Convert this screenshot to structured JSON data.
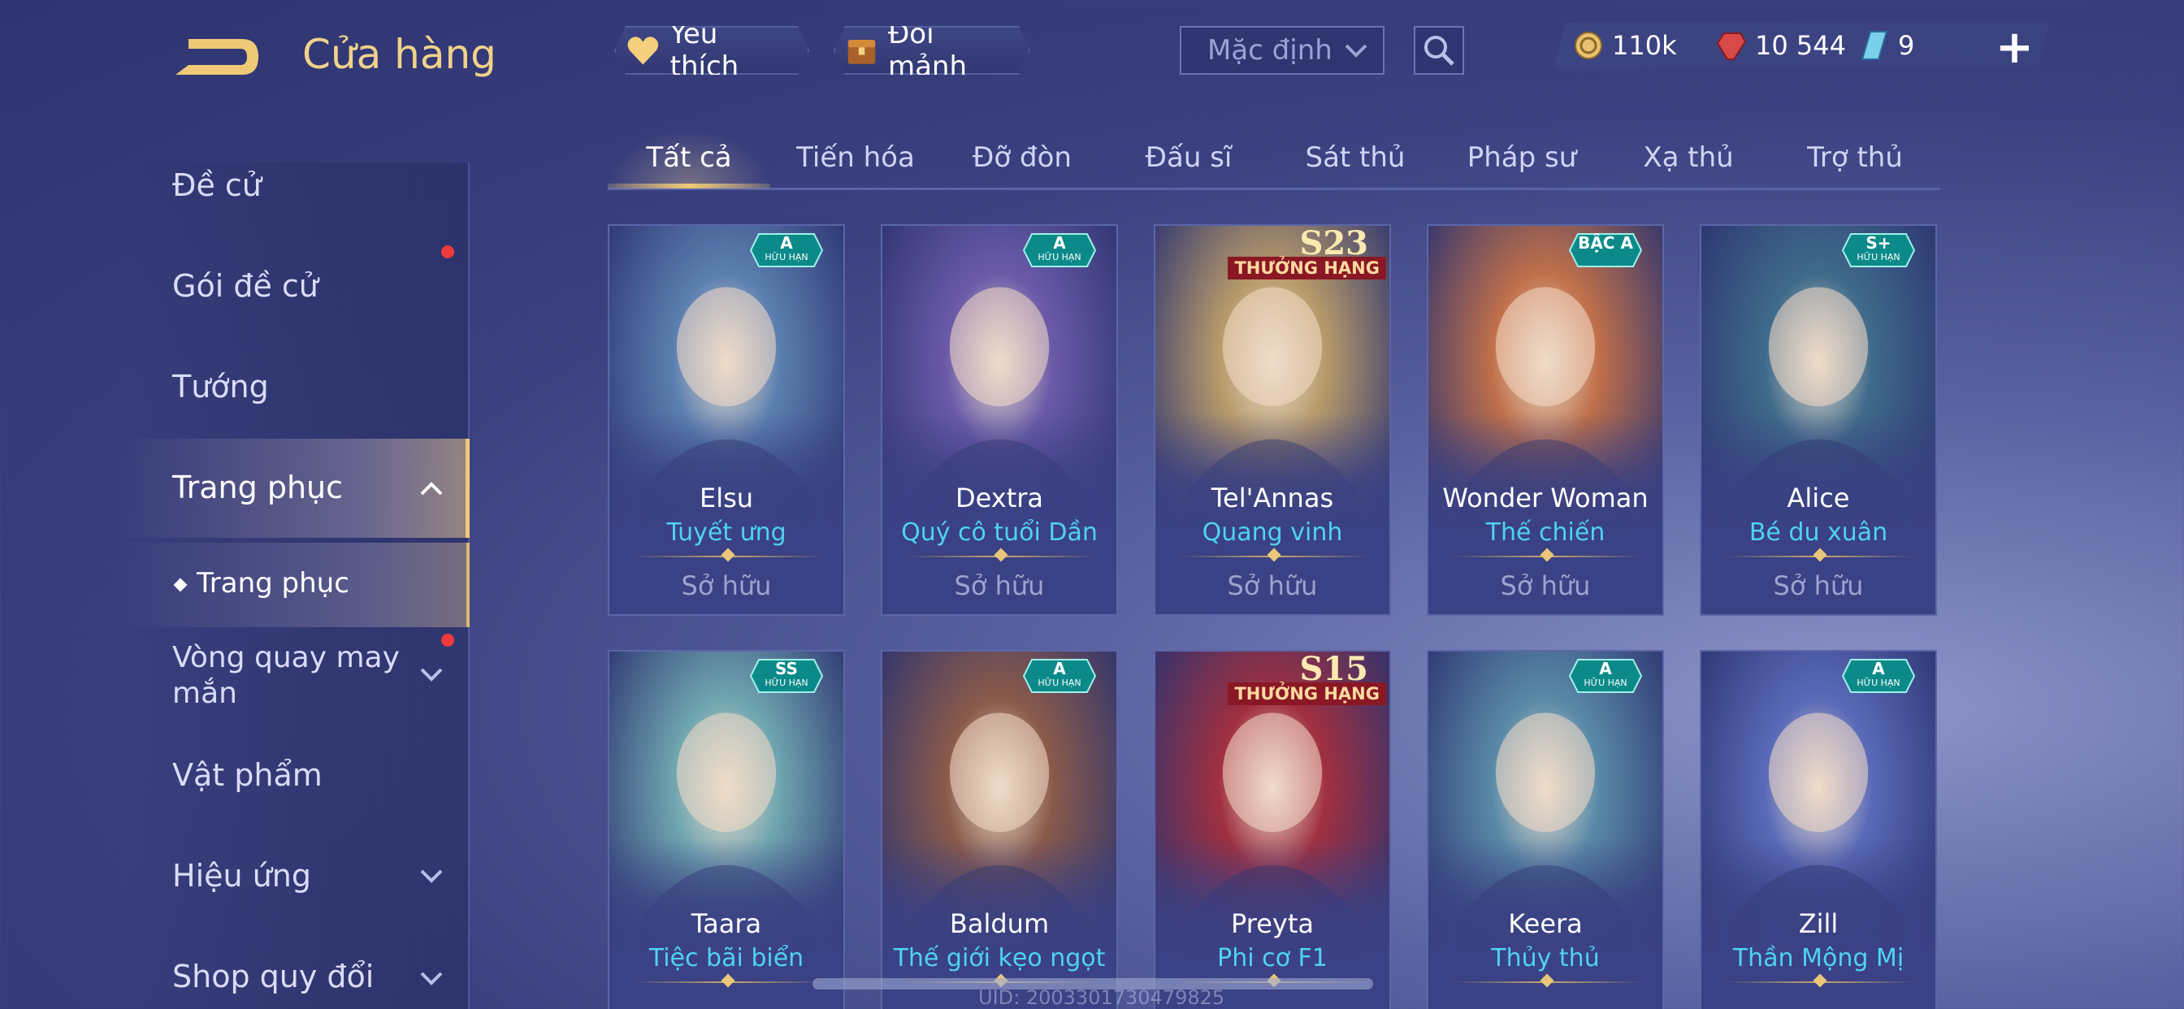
{
  "header": {
    "title": "Cửa hàng",
    "favorite_label": "Yêu thích",
    "exchange_label": "Đổi mảnh",
    "sort_value": "Mặc định",
    "currencies": [
      {
        "icon": "gold-coin-icon",
        "value": "110k"
      },
      {
        "icon": "red-gem-icon",
        "value": "10 544"
      },
      {
        "icon": "voucher-icon",
        "value": "9"
      }
    ],
    "add_label": "+"
  },
  "sidebar": {
    "items": [
      {
        "label": "Đề cử"
      },
      {
        "label": "Gói đề cử"
      },
      {
        "label": "Tướng"
      },
      {
        "label": "Trang phục"
      },
      {
        "label": "Trang phục"
      },
      {
        "label": "Vòng quay may mắn"
      },
      {
        "label": "Vật phẩm"
      },
      {
        "label": "Hiệu ứng"
      },
      {
        "label": "Shop quy đổi"
      }
    ]
  },
  "tabs": [
    "Tất cả",
    "Tiến hóa",
    "Đỡ đòn",
    "Đấu sĩ",
    "Sát thủ",
    "Pháp sư",
    "Xạ thủ",
    "Trợ thủ"
  ],
  "cards": [
    {
      "hero": "Elsu",
      "skin": "Tuyết ưng",
      "status": "Sở hữu",
      "badge": "A",
      "badge_sub": "HỮU HẠN",
      "art_color": "#5b7fb0"
    },
    {
      "hero": "Dextra",
      "skin": "Quý cô tuổi Dần",
      "status": "Sở hữu",
      "badge": "A",
      "badge_sub": "HỮU HẠN",
      "art_color": "#6a5aa8"
    },
    {
      "hero": "Tel'Annas",
      "skin": "Quang vinh",
      "status": "Sở hữu",
      "rank": "S23",
      "rank_sub": "THƯỞNG HẠNG",
      "art_color": "#b89a6a"
    },
    {
      "hero": "Wonder Woman",
      "skin": "Thế chiến",
      "status": "Sở hữu",
      "badge": "BẬC A",
      "badge_sub": "",
      "art_color": "#c0704a"
    },
    {
      "hero": "Alice",
      "skin": "Bé du xuân",
      "status": "Sở hữu",
      "badge": "S+",
      "badge_sub": "HỮU HẠN",
      "art_color": "#3f6a8a"
    },
    {
      "hero": "Taara",
      "skin": "Tiệc bãi biển",
      "status": "",
      "badge": "SS",
      "badge_sub": "HỮU HẠN",
      "art_color": "#6fa5b0"
    },
    {
      "hero": "Baldum",
      "skin": "Thế giới kẹo ngọt",
      "status": "",
      "badge": "A",
      "badge_sub": "HỮU HẠN",
      "art_color": "#8a5a4a"
    },
    {
      "hero": "Preyta",
      "skin": "Phi cơ F1",
      "status": "",
      "rank": "S15",
      "rank_sub": "THƯỞNG HẠNG",
      "art_color": "#a03040"
    },
    {
      "hero": "Keera",
      "skin": "Thủy thủ",
      "status": "",
      "badge": "A",
      "badge_sub": "HỮU HẠN",
      "art_color": "#5a8aa8"
    },
    {
      "hero": "Zill",
      "skin": "Thần Mộng Mị",
      "status": "",
      "badge": "A",
      "badge_sub": "HỮU HẠN",
      "art_color": "#5a6ab8"
    }
  ],
  "footer": {
    "uid": "UID: 2003301730479825"
  },
  "colors": {
    "accent": "#f0c978",
    "skin_name": "#4fd2f0",
    "notification": "#ef3b3b"
  }
}
